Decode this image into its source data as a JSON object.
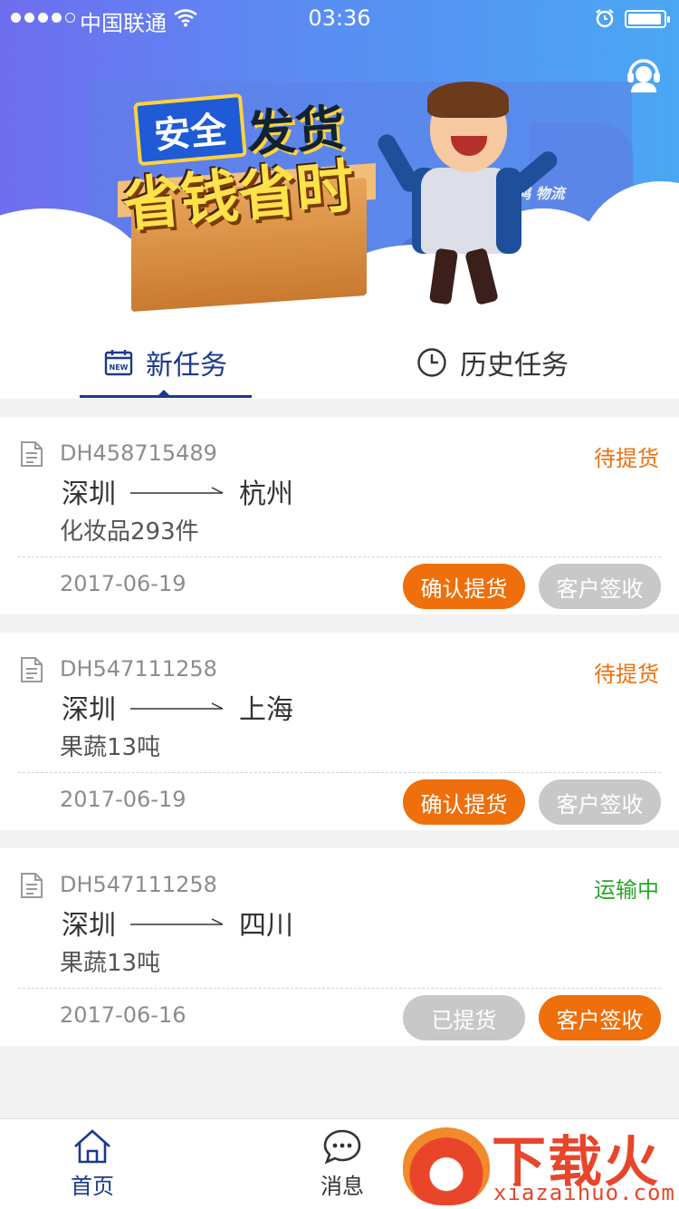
{
  "status_bar": {
    "carrier": "中国联通",
    "time": "03:36"
  },
  "banner": {
    "headline_line1_a": "安全",
    "headline_line1_b": "发货",
    "headline_line2": "省钱省时",
    "logo_text": "鸿 物流"
  },
  "tabs": [
    {
      "label": "新任务",
      "active": true,
      "icon": "calendar-new-icon"
    },
    {
      "label": "历史任务",
      "active": false,
      "icon": "clock-icon"
    }
  ],
  "colors": {
    "accent": "#1a3a8a",
    "orange": "#ee6f0b",
    "status_pending": "#ee6f0b",
    "status_transit": "#2aa52a",
    "disabled": "#c8c8c8"
  },
  "tasks": [
    {
      "order_no": "DH458715489",
      "status": "待提货",
      "from": "深圳",
      "to": "杭州",
      "goods": "化妆品293件",
      "date": "2017-06-19",
      "buttons": [
        {
          "label": "确认提货",
          "style": "orange"
        },
        {
          "label": "客户签收",
          "style": "gray"
        }
      ]
    },
    {
      "order_no": "DH547111258",
      "status": "待提货",
      "from": "深圳",
      "to": "上海",
      "goods": "果蔬13吨",
      "date": "2017-06-19",
      "buttons": [
        {
          "label": "确认提货",
          "style": "orange"
        },
        {
          "label": "客户签收",
          "style": "gray"
        }
      ]
    },
    {
      "order_no": "DH547111258",
      "status": "运输中",
      "from": "深圳",
      "to": "四川",
      "goods": "果蔬13吨",
      "date": "2017-06-16",
      "buttons": [
        {
          "label": "已提货",
          "style": "gray"
        },
        {
          "label": "客户签收",
          "style": "orange"
        }
      ]
    }
  ],
  "bottom_nav": [
    {
      "label": "首页",
      "icon": "home-icon",
      "active": true
    },
    {
      "label": "消息",
      "icon": "chat-icon",
      "active": false
    }
  ],
  "watermark": {
    "title": "下载火",
    "url": "xiazaihuo.com"
  }
}
